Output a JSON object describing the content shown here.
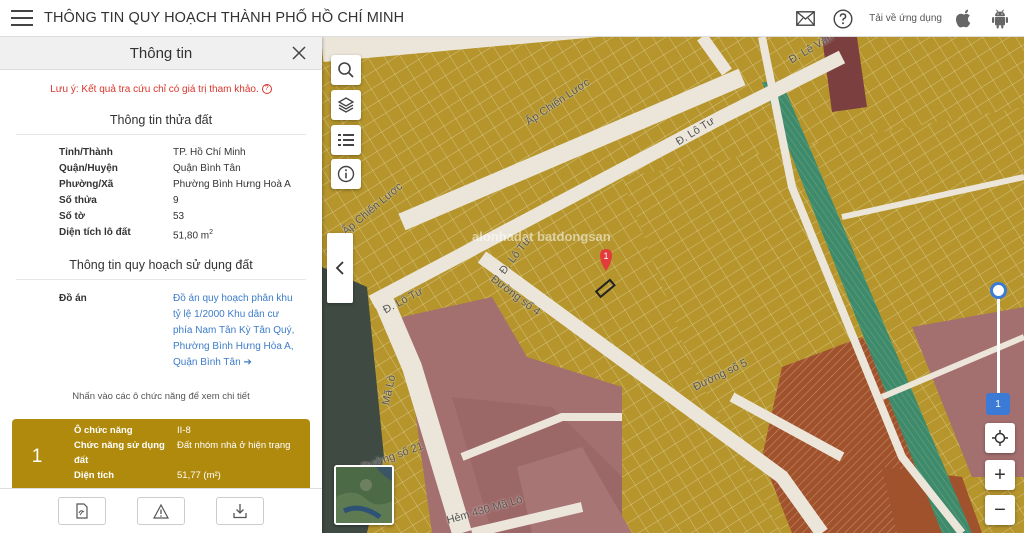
{
  "header": {
    "title": "THÔNG TIN QUY HOẠCH THÀNH PHỐ HỒ CHÍ MINH",
    "app_download": "Tải về ứng dụng"
  },
  "panel": {
    "title": "Thông tin",
    "note": "Lưu ý: Kết quả tra cứu chỉ có giá trị tham khảo.",
    "note_icon": "?",
    "parcel_section": "Thông tin thửa đất",
    "parcel": [
      {
        "key": "Tỉnh/Thành",
        "value": "TP. Hồ Chí Minh"
      },
      {
        "key": "Quận/Huyện",
        "value": "Quận Bình Tân"
      },
      {
        "key": "Phường/Xã",
        "value": "Phường Bình Hưng Hoà A"
      },
      {
        "key": "Số thửa",
        "value": "9"
      },
      {
        "key": "Số tờ",
        "value": "53"
      },
      {
        "key": "Diện tích lô đất",
        "value": "51,80 m",
        "value_sup": "2"
      }
    ],
    "planning_section": "Thông tin quy hoạch sử dụng đất",
    "plan_key": "Đồ án",
    "plan_value": "Đồ án quy hoạch phân khu tỷ lệ 1/2000 Khu dân cư phía Nam Tân Kỳ Tân Quý, Phường Bình Hưng Hòa A, Quận Bình Tân",
    "plan_arrow": "➔",
    "hint": "Nhấn vào các ô chức năng để xem chi tiết",
    "function_card": {
      "number": "1",
      "color": "#b08a0c",
      "rows": [
        {
          "key": "Ô chức năng",
          "value": "II-8"
        },
        {
          "key": "Chức năng sử dụng đất",
          "value": "Đất nhóm nhà ở hiện trạng"
        },
        {
          "key": "Diện tích",
          "value": "51,77 (m²)"
        }
      ]
    }
  },
  "map": {
    "streets": [
      "Ấp Chiến Lược",
      "Đ. Lê Văn",
      "Đ. Lô Tư",
      "Ấp Chiến Lược",
      "Đ. Lô Tư",
      "Đường số 4",
      "Đ. Lô Tư",
      "Mã Lò",
      "Đường số 5",
      "Đường số 21",
      "Hẻm 430 Mã Lò"
    ],
    "watermark": "alonhadat batdongsan",
    "marker_label": "1",
    "zoom_level": "1",
    "zoom_in": "+",
    "zoom_out": "−",
    "colors": {
      "residential": "#b5952c",
      "road": "#ece6da",
      "commercial": "#a46f6f",
      "green_strip": "#3f8a6a",
      "public": "#a0522d",
      "accent": "#3b7bd5"
    }
  }
}
